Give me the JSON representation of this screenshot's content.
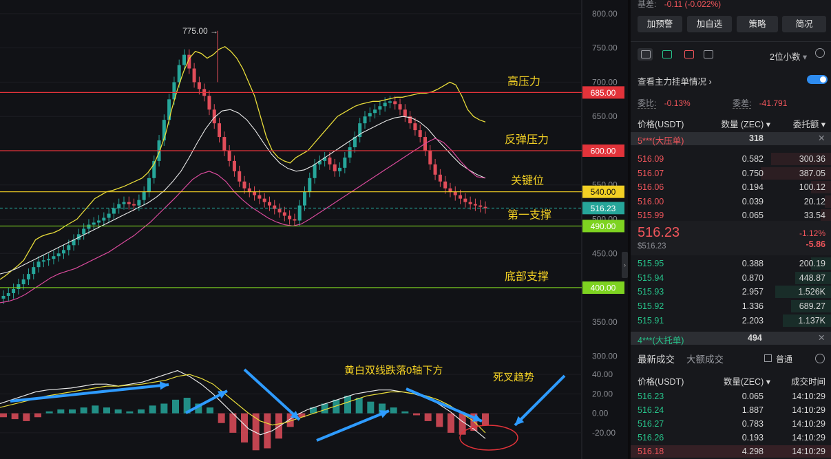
{
  "chart_data": {
    "type": "line",
    "price_axis": {
      "ylim": [
        287.5,
        820
      ],
      "ticks": [
        800,
        750,
        700,
        650,
        600,
        550,
        500,
        450,
        400,
        350,
        300
      ],
      "tick_labels": [
        "800.00",
        "750.00",
        "700.00",
        "650.00",
        "600.00",
        "550.00",
        "500.00",
        "450.00",
        "400.00",
        "350.00",
        "300.00"
      ]
    },
    "macd_axis": {
      "ylim": [
        -47,
        50
      ],
      "ticks": [
        40,
        20,
        0,
        -20
      ],
      "tick_labels": [
        "40.00",
        "20.00",
        "0.00",
        "-20.00"
      ]
    },
    "high_marker": {
      "value": 775,
      "label": "775.00"
    },
    "current_price": {
      "value": 516.23,
      "label": "516.23"
    },
    "levels": [
      {
        "value": 685,
        "label": "685.00",
        "text": "高压力",
        "color": "#e2333a"
      },
      {
        "value": 600,
        "label": "600.00",
        "text": "反弹压力",
        "color": "#e2333a"
      },
      {
        "value": 540,
        "label": "540.00",
        "text": "关键位",
        "color": "#f2d024"
      },
      {
        "value": 490,
        "label": "490.00",
        "text": "第一支撑",
        "color": "#7ed321"
      },
      {
        "value": 400,
        "label": "400.00",
        "text": "底部支撑",
        "color": "#7ed321"
      }
    ],
    "series": [
      {
        "color": "#26a69a",
        "values": [
          388,
          392,
          398,
          405,
          412,
          420,
          430,
          438,
          440,
          442,
          446,
          450,
          455,
          462,
          470,
          478,
          486,
          492,
          495,
          498,
          502,
          508,
          516,
          522,
          525,
          522,
          520,
          528,
          540,
          560,
          585,
          615,
          645,
          675,
          700,
          725,
          740,
          720,
          700,
          690,
          680,
          660,
          640,
          620,
          600,
          585,
          570,
          555,
          545,
          540,
          535,
          530,
          525,
          520,
          515,
          510,
          505,
          500,
          498,
          520,
          540,
          560,
          580,
          585,
          590,
          580,
          570,
          575,
          590,
          605,
          620,
          640,
          650,
          655,
          660,
          665,
          670,
          672,
          668,
          660,
          650,
          640,
          630,
          620,
          600,
          580,
          565,
          555,
          545,
          540,
          535,
          530,
          525,
          522,
          520,
          518,
          516
        ]
      },
      {
        "color": "#e8dc3a",
        "values": [
          412,
          418,
          425,
          432,
          440,
          455,
          470,
          475,
          478,
          480,
          484,
          490,
          495,
          500,
          510,
          520,
          530,
          535,
          540,
          542,
          545,
          548,
          552,
          556,
          560,
          568,
          580,
          600,
          625,
          660,
          690,
          715,
          735,
          745,
          742,
          735,
          740,
          748,
          752,
          745,
          735,
          720,
          700,
          680,
          650,
          620,
          600,
          590,
          585,
          582,
          590,
          595,
          600,
          610,
          620,
          630,
          640,
          650,
          655,
          660,
          665,
          668,
          670,
          672,
          672,
          674,
          676,
          678,
          678,
          680,
          682,
          684,
          684,
          686,
          690,
          695,
          700,
          696,
          680,
          660,
          650,
          645,
          642
        ]
      },
      {
        "color": "#e8e8e8",
        "values": [
          420,
          423,
          428,
          434,
          440,
          446,
          452,
          458,
          464,
          470,
          476,
          482,
          488,
          494,
          500,
          506,
          512,
          518,
          524,
          532,
          542,
          555,
          570,
          590,
          612,
          632,
          648,
          658,
          660,
          655,
          645,
          630,
          612,
          595,
          582,
          574,
          570,
          572,
          578,
          586,
          594,
          602,
          610,
          618,
          626,
          632,
          638,
          644,
          648,
          650,
          648,
          642,
          632,
          618,
          605,
          592,
          580,
          572,
          565,
          560
        ]
      },
      {
        "color": "#d94a9c",
        "values": [
          378,
          380,
          384,
          390,
          398,
          406,
          414,
          420,
          424,
          428,
          434,
          440,
          446,
          452,
          460,
          468,
          476,
          486,
          496,
          508,
          520,
          532,
          545,
          558,
          566,
          570,
          565,
          555,
          540,
          528,
          518,
          510,
          502,
          496,
          492,
          490,
          493,
          500,
          508,
          516,
          524,
          532,
          540,
          548,
          556,
          564,
          572,
          580,
          588,
          596,
          604,
          612,
          618,
          612,
          600,
          585,
          572,
          562,
          560
        ]
      }
    ],
    "macd": {
      "dif": [
        10,
        14,
        18,
        22,
        24,
        25,
        26,
        28,
        30,
        30,
        28,
        30,
        32,
        36,
        40,
        44,
        38,
        30,
        20,
        8,
        -4,
        -16,
        -22,
        -18,
        -10,
        -2,
        4,
        8,
        12,
        16,
        20,
        22,
        24,
        24,
        22,
        20,
        16,
        10,
        2,
        -8,
        -16,
        -26
      ],
      "dea": [
        6,
        9,
        12,
        15,
        18,
        20,
        22,
        24,
        26,
        28,
        28,
        29,
        30,
        32,
        34,
        38,
        40,
        36,
        30,
        20,
        10,
        0,
        -8,
        -12,
        -10,
        -6,
        -2,
        2,
        6,
        10,
        14,
        18,
        20,
        22,
        22,
        20,
        18,
        14,
        8,
        0,
        -8,
        -20
      ],
      "hist": [
        -4,
        -6,
        -8,
        -4,
        2,
        4,
        4,
        6,
        8,
        6,
        4,
        2,
        4,
        8,
        10,
        14,
        16,
        10,
        6,
        -10,
        -20,
        -30,
        -38,
        -36,
        -26,
        -14,
        -4,
        6,
        10,
        14,
        18,
        16,
        12,
        10,
        6,
        2,
        -2,
        -8,
        -14,
        -20,
        -22,
        -18,
        -12
      ]
    },
    "annotations": [
      "黄白双线跌落0轴下方",
      "死叉趋势"
    ]
  },
  "panel": {
    "basis_label": "基差:",
    "basis_value": "-0.11 (-0.022%)",
    "buttons": [
      "加预警",
      "加自选",
      "策略",
      "简况"
    ],
    "decimals": "2位小数",
    "orders_link": "查看主力挂单情况",
    "ratio_label": "委比:",
    "ratio_value": "-0.13%",
    "diff_label": "委差:",
    "diff_value": "-41.791",
    "headers": {
      "price": "价格(USDT)",
      "qty": "数量 (ZEC)",
      "amount": "委托额"
    },
    "big_ask": {
      "label": "5***(大压单)",
      "value": "318"
    },
    "asks": [
      {
        "price": "516.09",
        "qty": "0.582",
        "amount": "300.36",
        "fill": 0.3
      },
      {
        "price": "516.07",
        "qty": "0.750",
        "amount": "387.05",
        "fill": 0.35
      },
      {
        "price": "516.06",
        "qty": "0.194",
        "amount": "100.12",
        "fill": 0.1
      },
      {
        "price": "516.00",
        "qty": "0.039",
        "amount": "20.12",
        "fill": 0.03
      },
      {
        "price": "515.99",
        "qty": "0.065",
        "amount": "33.54",
        "fill": 0.05
      }
    ],
    "last": {
      "price": "516.23",
      "usd": "$516.23",
      "pct": "-1.12%",
      "chg": "-5.86"
    },
    "bids": [
      {
        "price": "515.95",
        "qty": "0.388",
        "amount": "200.19",
        "fill": 0.1
      },
      {
        "price": "515.94",
        "qty": "0.870",
        "amount": "448.87",
        "fill": 0.18
      },
      {
        "price": "515.93",
        "qty": "2.957",
        "amount": "1.526K",
        "fill": 0.28
      },
      {
        "price": "515.92",
        "qty": "1.336",
        "amount": "689.27",
        "fill": 0.2
      },
      {
        "price": "515.91",
        "qty": "2.203",
        "amount": "1.137K",
        "fill": 0.24
      }
    ],
    "big_bid": {
      "label": "4***(大托单)",
      "value": "494"
    },
    "tabs": [
      "最新成交",
      "大额成交"
    ],
    "normal": "普通",
    "trade_headers": {
      "price": "价格(USDT)",
      "qty": "数量(ZEC)",
      "time": "成交时间"
    },
    "trades": [
      {
        "price": "516.23",
        "qty": "0.065",
        "time": "14:10:29",
        "side": "buy"
      },
      {
        "price": "516.24",
        "qty": "1.887",
        "time": "14:10:29",
        "side": "buy"
      },
      {
        "price": "516.27",
        "qty": "0.783",
        "time": "14:10:29",
        "side": "buy"
      },
      {
        "price": "516.26",
        "qty": "0.193",
        "time": "14:10:29",
        "side": "buy"
      },
      {
        "price": "516.18",
        "qty": "4.298",
        "time": "14:10:29",
        "side": "sell"
      }
    ]
  }
}
